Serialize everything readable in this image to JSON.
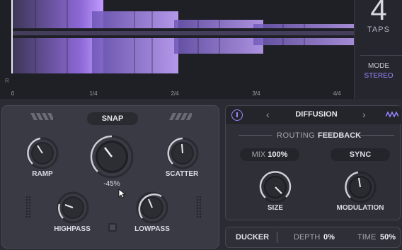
{
  "timeline": {
    "taps_count": "4",
    "taps_label": "TAPS",
    "mode_label": "MODE",
    "mode_value": "STEREO",
    "channel_label": "R",
    "ticks": [
      "0",
      "1/4",
      "2/4",
      "3/4",
      "4/4"
    ]
  },
  "left_panel": {
    "snap_label": "SNAP",
    "ramp_label": "RAMP",
    "center_value": "-45%",
    "scatter_label": "SCATTER",
    "highpass_label": "HIGHPASS",
    "lowpass_label": "LOWPASS"
  },
  "right_panel": {
    "effect_name": "DIFFUSION",
    "routing_label": "ROUTING",
    "routing_value": "FEEDBACK",
    "mix_label": "MIX",
    "mix_value": "100%",
    "sync_label": "SYNC",
    "size_label": "SIZE",
    "modulation_label": "MODULATION"
  },
  "bottom_bar": {
    "ducker_label": "DUCKER",
    "depth_label": "DEPTH",
    "depth_value": "0%",
    "time_label": "TIME",
    "time_value": "50%"
  },
  "colors": {
    "accent": "#9b86ff",
    "tap_gradient_start": "#3b3555",
    "tap_gradient_end": "#b78cff",
    "panel": "#393a43",
    "background": "#2b2c33"
  },
  "icons": [
    "power-icon",
    "chevron-left-icon",
    "chevron-right-icon",
    "wave-icon",
    "link-icon",
    "cursor-icon",
    "slash-decor-icon"
  ]
}
